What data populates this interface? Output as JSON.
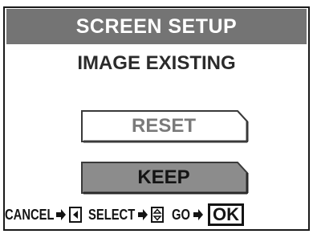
{
  "screen": {
    "title": "SCREEN SETUP",
    "heading": "IMAGE EXISTING"
  },
  "options": [
    {
      "label": "RESET",
      "selected": false
    },
    {
      "label": "KEEP",
      "selected": true
    }
  ],
  "footer": {
    "cancel_label": "CANCEL",
    "select_label": "SELECT",
    "go_label": "GO",
    "ok_label": "OK"
  },
  "colors": {
    "title_bar": "#747474",
    "selected_option": "#8c8c8c",
    "unselected_option": "#ffffff",
    "text_dark": "#141414",
    "text_dim": "#7a7a7a"
  }
}
